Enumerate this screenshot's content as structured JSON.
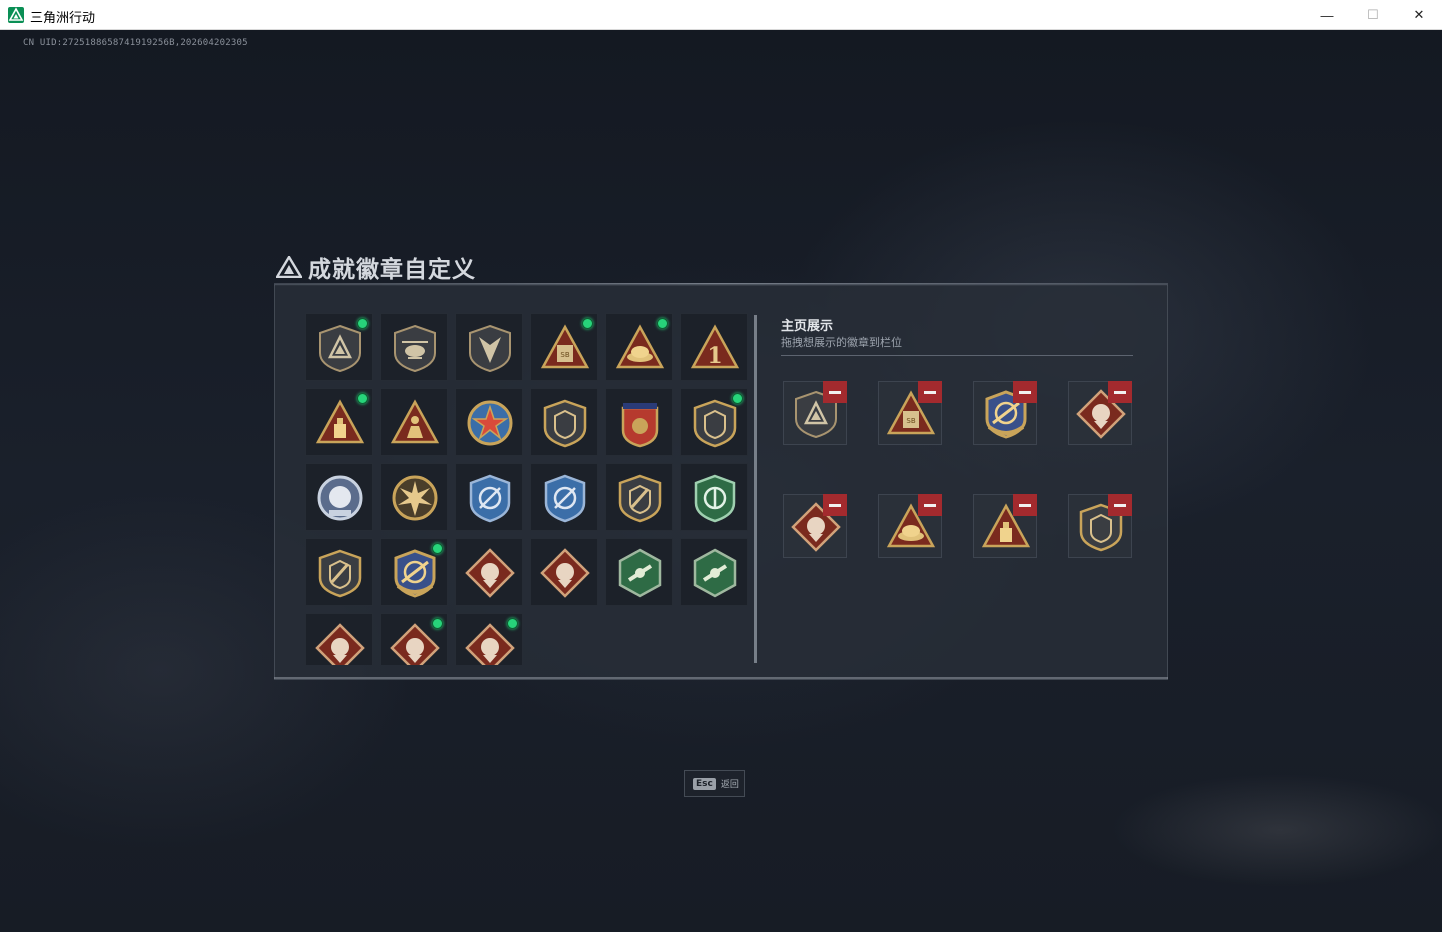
{
  "window": {
    "title": "三角洲行动",
    "minimize_glyph": "—",
    "maximize_glyph": "☐",
    "close_glyph": "✕"
  },
  "uid_text": "CN UID:2725188658741919256B,202604202305",
  "page_title": "成就徽章自定义",
  "collection": {
    "badges": [
      {
        "icon": "shield-triangle-badge-icon",
        "new": true
      },
      {
        "icon": "helicopter-badge-icon",
        "new": false
      },
      {
        "icon": "arrowhead-shield-badge-icon",
        "new": false
      },
      {
        "icon": "sb-triangle-badge-icon",
        "new": true
      },
      {
        "icon": "coin-pile-triangle-badge-icon",
        "new": true
      },
      {
        "icon": "number-one-triangle-badge-icon",
        "new": false
      },
      {
        "icon": "gold-bar-triangle-badge-icon",
        "new": true
      },
      {
        "icon": "soldier-triangle-badge-icon",
        "new": false
      },
      {
        "icon": "star-medal-badge-icon",
        "new": false
      },
      {
        "icon": "wing-shield-badge-icon",
        "new": false
      },
      {
        "icon": "stars-crest-badge-icon",
        "new": false
      },
      {
        "icon": "lion-shield-badge-icon",
        "new": true
      },
      {
        "icon": "silver-emblem-badge-icon",
        "new": false
      },
      {
        "icon": "explosion-badge-icon",
        "new": false
      },
      {
        "icon": "blue-sniper-crest-badge-icon",
        "new": false
      },
      {
        "icon": "blue-target-crest-badge-icon",
        "new": false
      },
      {
        "icon": "blade-shield-badge-icon",
        "new": false
      },
      {
        "icon": "green-crest-badge-icon",
        "new": false
      },
      {
        "icon": "knife-shield-badge-icon",
        "new": false
      },
      {
        "icon": "gold-sniper-crest-badge-icon",
        "new": true
      },
      {
        "icon": "boar-diamond-badge-icon",
        "new": false
      },
      {
        "icon": "wolf-diamond-badge-icon",
        "new": false
      },
      {
        "icon": "eagle-hexagon-badge-icon",
        "new": false
      },
      {
        "icon": "rifle-hexagon-badge-icon",
        "new": false
      },
      {
        "icon": "dragon-diamond-badge-icon",
        "new": false
      },
      {
        "icon": "dragon-diamond-badge-icon",
        "new": true
      },
      {
        "icon": "horse-diamond-badge-icon",
        "new": true
      }
    ]
  },
  "showcase": {
    "title": "主页展示",
    "subtitle": "拖拽想展示的徽章到栏位",
    "slots": [
      {
        "icon": "shield-triangle-badge-icon"
      },
      {
        "icon": "sb-triangle-badge-icon"
      },
      {
        "icon": "gold-sniper-crest-badge-icon"
      },
      {
        "icon": "dragon-diamond-badge-icon"
      },
      {
        "icon": "horse-diamond-badge-icon"
      },
      {
        "icon": "coin-pile-triangle-badge-icon"
      },
      {
        "icon": "gold-bar-triangle-badge-icon"
      },
      {
        "icon": "lion-shield-badge-icon"
      }
    ]
  },
  "footer": {
    "esc_key": "Esc",
    "esc_label": "返回"
  },
  "colors": {
    "new_dot": "#27d47a",
    "remove_button": "#a32a2e",
    "badge_gold": "#c9a45a",
    "badge_red": "#7a2a1e",
    "badge_blue": "#3b6ea8",
    "badge_green": "#2e6b45"
  }
}
